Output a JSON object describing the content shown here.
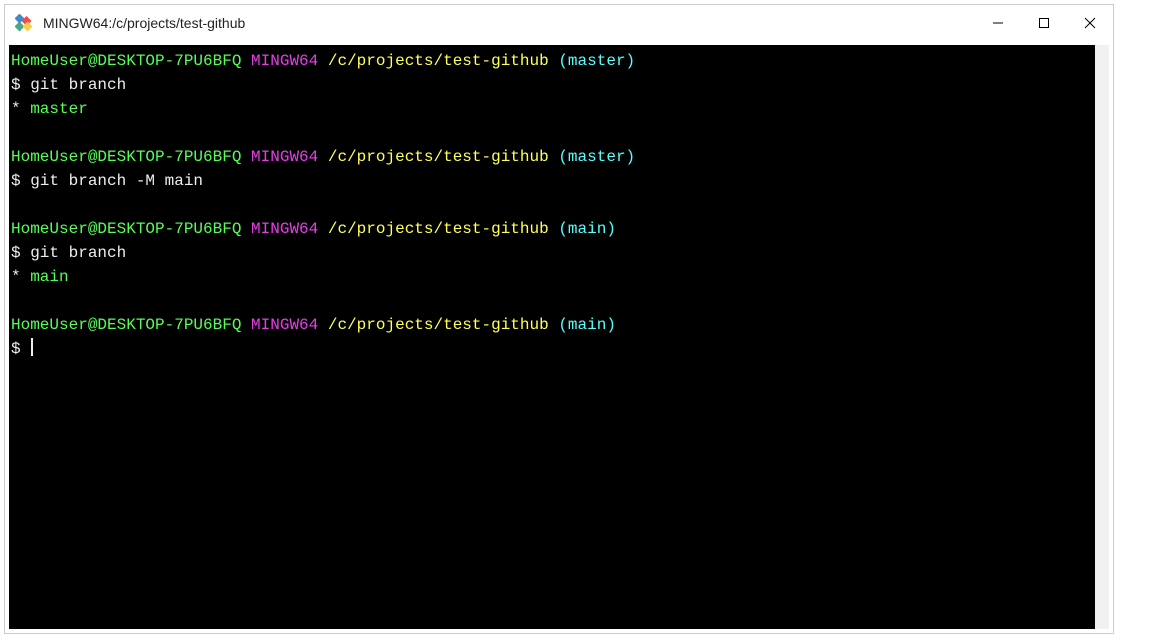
{
  "window": {
    "title": "MINGW64:/c/projects/test-github"
  },
  "terminal": {
    "blocks": [
      {
        "user_host": "HomeUser@DESKTOP-7PU6BFQ",
        "context": "MINGW64",
        "path": "/c/projects/test-github",
        "branch_open": "(",
        "branch": "master",
        "branch_close": ")",
        "prompt": "$",
        "command": "git branch",
        "output_marker": "*",
        "output_text": "master"
      },
      {
        "user_host": "HomeUser@DESKTOP-7PU6BFQ",
        "context": "MINGW64",
        "path": "/c/projects/test-github",
        "branch_open": "(",
        "branch": "master",
        "branch_close": ")",
        "prompt": "$",
        "command": "git branch -M main",
        "output_marker": "",
        "output_text": ""
      },
      {
        "user_host": "HomeUser@DESKTOP-7PU6BFQ",
        "context": "MINGW64",
        "path": "/c/projects/test-github",
        "branch_open": "(",
        "branch": "main",
        "branch_close": ")",
        "prompt": "$",
        "command": "git branch",
        "output_marker": "*",
        "output_text": "main"
      },
      {
        "user_host": "HomeUser@DESKTOP-7PU6BFQ",
        "context": "MINGW64",
        "path": "/c/projects/test-github",
        "branch_open": "(",
        "branch": "main",
        "branch_close": ")",
        "prompt": "$",
        "command": "",
        "output_marker": "",
        "output_text": ""
      }
    ]
  }
}
